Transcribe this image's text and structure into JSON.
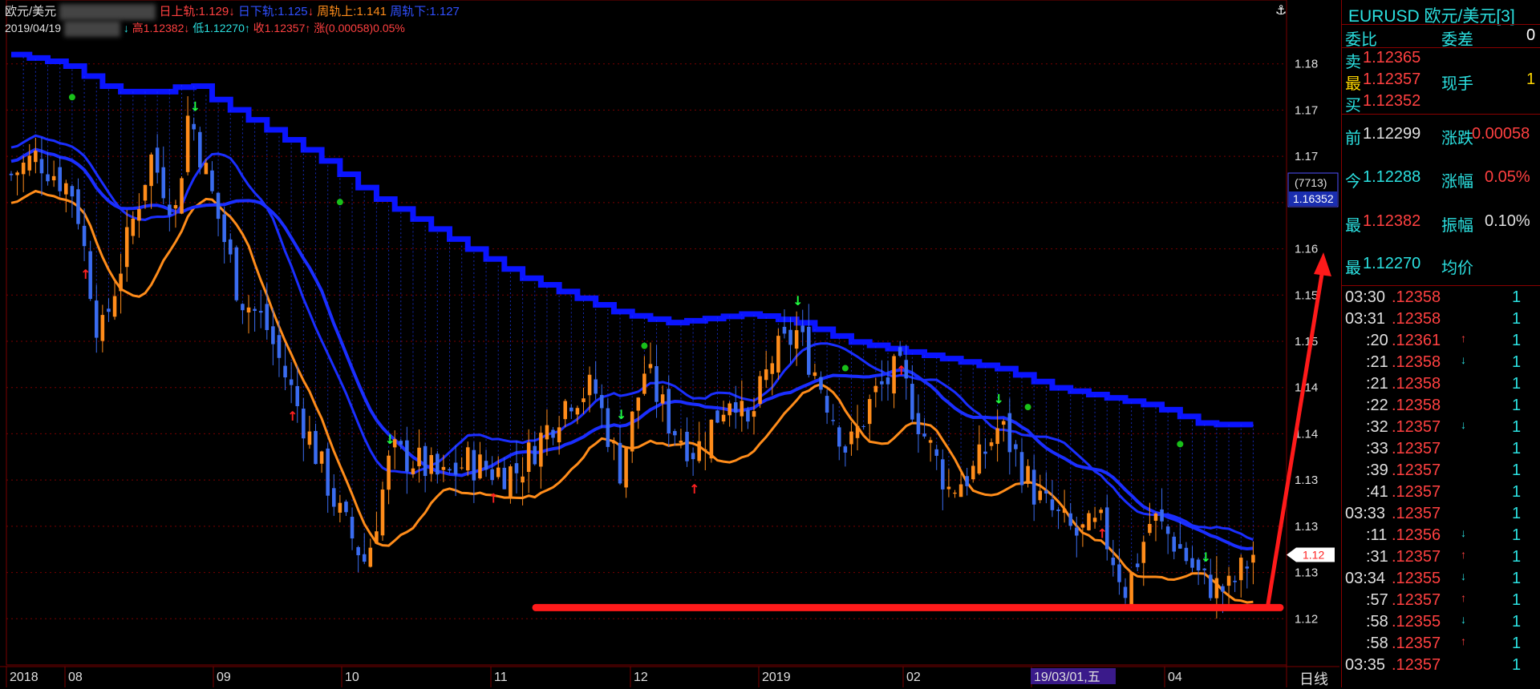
{
  "header": {
    "symbol": "欧元/美元",
    "day_upper_label": "日上轨:1.129",
    "day_upper_arrow": "↓",
    "day_lower_label": "日下轨:1.125",
    "day_lower_arrow": "↓",
    "week_upper_label": "周轨上:1.141",
    "week_lower_label": "周轨下:1.127",
    "date": "2019/04/19",
    "down_arrow": "↓",
    "high_label": "高1.12382",
    "high_arrow": "↓",
    "low_label": "低1.12270",
    "low_arrow": "↑",
    "close_label": "收1.12357",
    "close_arrow": "↑",
    "change_label": "涨(0.00058)0.05%"
  },
  "price_axis": {
    "ticks": [
      "1.18",
      "1.17",
      "1.17",
      "1.16",
      "1.16",
      "1.15",
      "1.15",
      "1.14",
      "1.14",
      "1.13",
      "1.13",
      "1.13",
      "1.12"
    ],
    "crosshair_count": "(7713)",
    "crosshair_price": "1.16352",
    "last_price_tag": "1.12",
    "period_label": "日线"
  },
  "time_axis": {
    "labels": [
      "2018",
      "08",
      "09",
      "10",
      "11",
      "12",
      "2019",
      "02",
      "03",
      "04"
    ],
    "selected_date": "19/03/01,五"
  },
  "colors": {
    "up": "#ff8c1a",
    "down": "#3a6cf0",
    "upper_band": "#0a14ff",
    "grid": "#7a0000",
    "support_line": "#ff1a1a",
    "cyan_text": "#2be0e0",
    "red_text": "#ff4040"
  },
  "panel": {
    "title": "EURUSD 欧元/美元[3]",
    "weibi_label": "委比",
    "weicha_label": "委差",
    "weicha_value": "0",
    "sell_label": "卖",
    "sell_value": "1.12365",
    "last_label": "最",
    "last_value": "1.12357",
    "spot_label": "现手",
    "spot_value": "1",
    "buy_label": "买",
    "buy_value": "1.12352",
    "prev_label": "前",
    "prev_value": "1.12299",
    "change_label": "涨跌",
    "change_value": "0.00058",
    "open_label": "今",
    "open_value": "1.12288",
    "change_pct_label": "涨幅",
    "change_pct_value": "0.05%",
    "high_label": "最",
    "high_value": "1.12382",
    "amplitude_label": "振幅",
    "amplitude_value": "0.10%",
    "low_label": "最",
    "low_value": "1.12270",
    "avg_label": "均价",
    "ticks": [
      {
        "time": "03:30",
        "price": ".12358",
        "arrow": "",
        "vol": "1"
      },
      {
        "time": "03:31",
        "price": ".12358",
        "arrow": "",
        "vol": "1"
      },
      {
        "time": ":20",
        "price": ".12361",
        "arrow": "↑",
        "vol": "1"
      },
      {
        "time": ":21",
        "price": ".12358",
        "arrow": "↓",
        "vol": "1"
      },
      {
        "time": ":21",
        "price": ".12358",
        "arrow": "",
        "vol": "1"
      },
      {
        "time": ":22",
        "price": ".12358",
        "arrow": "",
        "vol": "1"
      },
      {
        "time": ":32",
        "price": ".12357",
        "arrow": "↓",
        "vol": "1"
      },
      {
        "time": ":33",
        "price": ".12357",
        "arrow": "",
        "vol": "1"
      },
      {
        "time": ":39",
        "price": ".12357",
        "arrow": "",
        "vol": "1"
      },
      {
        "time": ":41",
        "price": ".12357",
        "arrow": "",
        "vol": "1"
      },
      {
        "time": "03:33",
        "price": ".12357",
        "arrow": "",
        "vol": "1"
      },
      {
        "time": ":11",
        "price": ".12356",
        "arrow": "↓",
        "vol": "1"
      },
      {
        "time": ":31",
        "price": ".12357",
        "arrow": "↑",
        "vol": "1"
      },
      {
        "time": "03:34",
        "price": ".12355",
        "arrow": "↓",
        "vol": "1"
      },
      {
        "time": ":57",
        "price": ".12357",
        "arrow": "↑",
        "vol": "1"
      },
      {
        "time": ":58",
        "price": ".12355",
        "arrow": "↓",
        "vol": "1"
      },
      {
        "time": ":58",
        "price": ".12357",
        "arrow": "↑",
        "vol": "1"
      },
      {
        "time": "03:35",
        "price": ".12357",
        "arrow": "",
        "vol": "1"
      }
    ]
  },
  "chart_data": {
    "type": "candlestick",
    "title": "欧元/美元",
    "period": "日线",
    "ylim": [
      1.115,
      1.185
    ],
    "y_ticks": [
      1.12,
      1.125,
      1.13,
      1.135,
      1.14,
      1.145,
      1.15,
      1.155,
      1.16,
      1.165,
      1.17,
      1.175,
      1.18
    ],
    "x_start": "2018-07",
    "x_end": "2019-04-19",
    "n_bars": 205,
    "candles": [],
    "close_path_keypoints": [
      [
        0,
        1.168
      ],
      [
        10,
        1.17
      ],
      [
        25,
        1.166
      ],
      [
        35,
        1.15
      ],
      [
        45,
        1.16
      ],
      [
        55,
        1.17
      ],
      [
        65,
        1.164
      ],
      [
        70,
        1.175
      ],
      [
        80,
        1.165
      ],
      [
        90,
        1.155
      ],
      [
        100,
        1.152
      ],
      [
        110,
        1.145
      ],
      [
        120,
        1.138
      ],
      [
        130,
        1.131
      ],
      [
        140,
        1.126
      ],
      [
        150,
        1.138
      ],
      [
        160,
        1.137
      ],
      [
        170,
        1.135
      ],
      [
        180,
        1.137
      ],
      [
        190,
        1.136
      ],
      [
        200,
        1.136
      ],
      [
        210,
        1.14
      ],
      [
        220,
        1.144
      ],
      [
        230,
        1.145
      ],
      [
        240,
        1.136
      ],
      [
        250,
        1.147
      ],
      [
        260,
        1.141
      ],
      [
        270,
        1.138
      ],
      [
        285,
        1.145
      ],
      [
        290,
        1.14
      ],
      [
        300,
        1.148
      ],
      [
        310,
        1.151
      ],
      [
        320,
        1.145
      ],
      [
        330,
        1.138
      ],
      [
        340,
        1.144
      ],
      [
        350,
        1.147
      ],
      [
        360,
        1.14
      ],
      [
        370,
        1.134
      ],
      [
        380,
        1.136
      ],
      [
        390,
        1.141
      ],
      [
        405,
        1.133
      ],
      [
        420,
        1.129
      ],
      [
        430,
        1.13
      ],
      [
        440,
        1.123
      ],
      [
        450,
        1.131
      ],
      [
        460,
        1.128
      ],
      [
        470,
        1.124
      ],
      [
        480,
        1.123
      ],
      [
        490,
        1.127
      ]
    ],
    "support_line_price": 1.1212,
    "upper_band_keypoints": [
      [
        0,
        1.181
      ],
      [
        20,
        1.18
      ],
      [
        40,
        1.177
      ],
      [
        60,
        1.177
      ],
      [
        70,
        1.178
      ],
      [
        80,
        1.176
      ],
      [
        100,
        1.173
      ],
      [
        120,
        1.17
      ],
      [
        140,
        1.166
      ],
      [
        160,
        1.163
      ],
      [
        180,
        1.16
      ],
      [
        200,
        1.157
      ],
      [
        220,
        1.155
      ],
      [
        240,
        1.153
      ],
      [
        260,
        1.152
      ],
      [
        290,
        1.153
      ],
      [
        310,
        1.152
      ],
      [
        330,
        1.15
      ],
      [
        350,
        1.149
      ],
      [
        370,
        1.148
      ],
      [
        390,
        1.147
      ],
      [
        410,
        1.145
      ],
      [
        430,
        1.144
      ],
      [
        450,
        1.143
      ],
      [
        470,
        1.141
      ],
      [
        480,
        1.141
      ]
    ]
  }
}
